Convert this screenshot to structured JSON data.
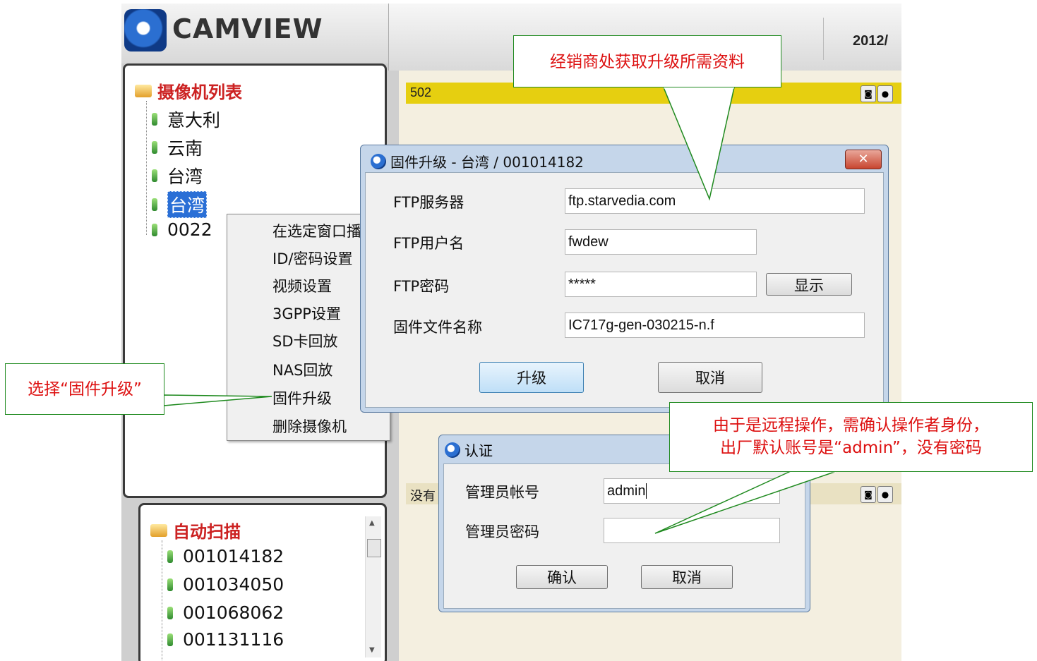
{
  "app": {
    "logo_text": "CAMVIEW",
    "datetime": "2012/"
  },
  "camera_list": {
    "title": "摄像机列表",
    "items": [
      "意大利",
      "云南",
      "台湾",
      "台湾",
      "0022"
    ]
  },
  "auto_scan": {
    "title": "自动扫描",
    "items": [
      "001014182",
      "001034050",
      "001068062",
      "001131116"
    ]
  },
  "video": {
    "top_label": "502",
    "bottom_label": "没有"
  },
  "context_menu": {
    "items": [
      "在选定窗口播",
      "ID/密码设置",
      "视频设置",
      "3GPP设置",
      "SD卡回放",
      "NAS回放",
      "固件升级",
      "删除摄像机"
    ]
  },
  "firmware_dialog": {
    "title": "固件升级 - 台湾 / 001014182",
    "close_label": "✕",
    "ftp_server_label": "FTP服务器",
    "ftp_server_value": "ftp.starvedia.com",
    "ftp_user_label": "FTP用户名",
    "ftp_user_value": "fwdew",
    "ftp_password_label": "FTP密码",
    "ftp_password_value": "*****",
    "show_button": "显示",
    "firmware_file_label": "固件文件名称",
    "firmware_file_value": "IC717g-gen-030215-n.f",
    "upgrade_button": "升级",
    "cancel_button": "取消"
  },
  "auth_dialog": {
    "title": "认证",
    "admin_account_label": "管理员帐号",
    "admin_account_value": "admin",
    "admin_password_label": "管理员密码",
    "admin_password_value": "",
    "confirm_button": "确认",
    "cancel_button": "取消"
  },
  "callouts": {
    "top": "经销商处获取升级所需资料",
    "left": "选择“固件升级”",
    "right_line1": "由于是远程操作，需确认操作者身份，",
    "right_line2": "出厂默认账号是“admin”，没有密码"
  },
  "colors": {
    "callout_border": "#1f8a1f",
    "callout_text": "#dd1111",
    "tree_title": "#cc2222",
    "selection": "#2a6fd6",
    "video_bar": "#e6cf10"
  }
}
